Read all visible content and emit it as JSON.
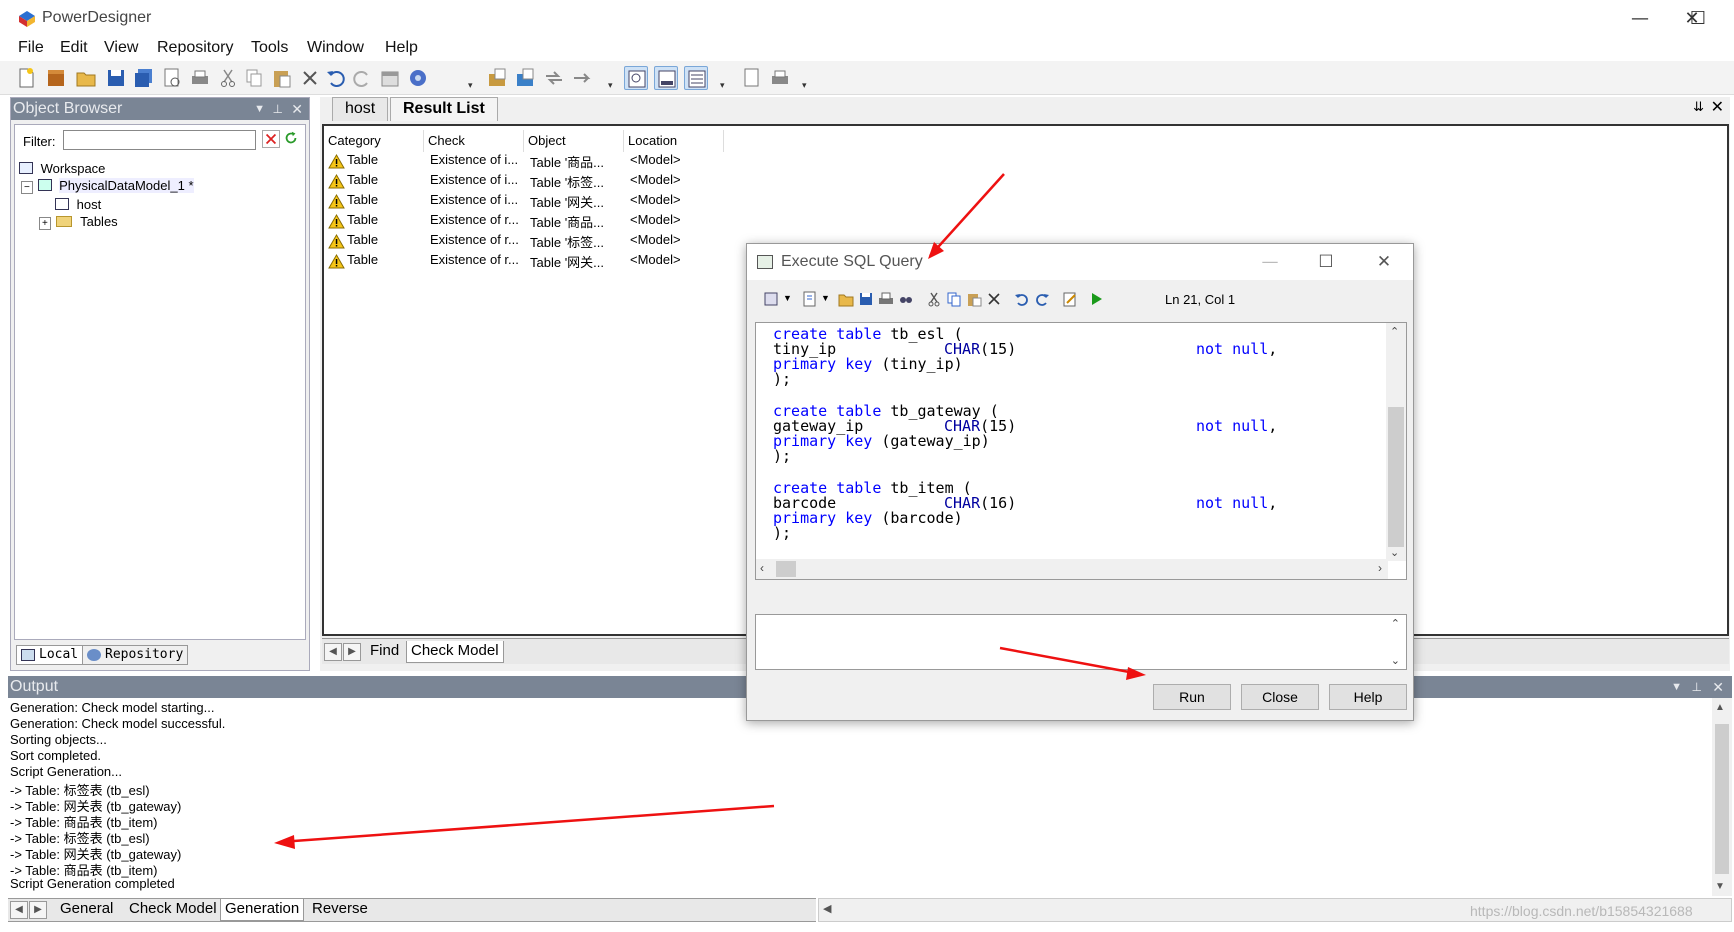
{
  "window": {
    "title": "PowerDesigner",
    "controls": [
      "—",
      "☐",
      "✕"
    ]
  },
  "menu": [
    "File",
    "Edit",
    "View",
    "Repository",
    "Tools",
    "Window",
    "Help"
  ],
  "object_browser": {
    "title": "Object Browser",
    "filter_label": "Filter:",
    "filter_value": "",
    "tree": {
      "workspace": "Workspace",
      "model": "PhysicalDataModel_1 *",
      "host": "host",
      "tables": "Tables"
    },
    "tabs": [
      "Local",
      "Repository"
    ]
  },
  "result_panel": {
    "tabs": [
      "host",
      "Result List"
    ],
    "columns": [
      "Category",
      "Check",
      "Object",
      "Location"
    ],
    "rows": [
      {
        "category": "Table",
        "check": "Existence of i...",
        "object": "Table '商品...",
        "location": "<Model>"
      },
      {
        "category": "Table",
        "check": "Existence of i...",
        "object": "Table '标签...",
        "location": "<Model>"
      },
      {
        "category": "Table",
        "check": "Existence of i...",
        "object": "Table '网关...",
        "location": "<Model>"
      },
      {
        "category": "Table",
        "check": "Existence of r...",
        "object": "Table '商品...",
        "location": "<Model>"
      },
      {
        "category": "Table",
        "check": "Existence of r...",
        "object": "Table '标签...",
        "location": "<Model>"
      },
      {
        "category": "Table",
        "check": "Existence of r...",
        "object": "Table '网关...",
        "location": "<Model>"
      }
    ],
    "bottom_tabs": [
      "Find",
      "Check Model"
    ]
  },
  "output": {
    "title": "Output",
    "lines": [
      "Generation: Check model starting...",
      "Generation: Check model successful.",
      "Sorting objects...",
      "Sort completed.",
      "Script Generation...",
      "-> Table: 标签表 (tb_esl)",
      "-> Table: 网关表 (tb_gateway)",
      "-> Table: 商品表 (tb_item)",
      "-> Table: 标签表 (tb_esl)",
      "-> Table: 网关表 (tb_gateway)",
      "-> Table: 商品表 (tb_item)",
      "Script Generation completed"
    ],
    "tabs": [
      "General",
      "Check Model",
      "Generation",
      "Reverse"
    ]
  },
  "dialog": {
    "title": "Execute SQL Query",
    "cursor_pos": "Ln 21, Col 1",
    "code": {
      "l1_kw": "create table",
      "l1_name": "tb_esl (",
      "l2_col": "tiny_ip",
      "l2_type": "CHAR",
      "l2_size": "(15)",
      "l2_null": "not null",
      "l3_kw": "primary key",
      "l3_rest": "(tiny_ip)",
      "l4": ");",
      "l5_kw": "create table",
      "l5_name": "tb_gateway (",
      "l6_col": "gateway_ip",
      "l6_type": "CHAR",
      "l6_size": "(15)",
      "l6_null": "not null",
      "l7_kw": "primary key",
      "l7_rest": "(gateway_ip)",
      "l8": ");",
      "l9_kw": "create table",
      "l9_name": "tb_item (",
      "l10_col": "barcode",
      "l10_type": "CHAR",
      "l10_size": "(16)",
      "l10_null": "not null",
      "l11_kw": "primary key",
      "l11_rest": "(barcode)",
      "l12": ");",
      "comma": ","
    },
    "buttons": {
      "run": "Run",
      "close": "Close",
      "help": "Help"
    }
  },
  "watermark": "https://blog.csdn.net/b15854321688",
  "colors": {
    "annotation_arrow": "#ee1111",
    "keyword": "#0000ff",
    "panel_header": "#7a8595"
  }
}
